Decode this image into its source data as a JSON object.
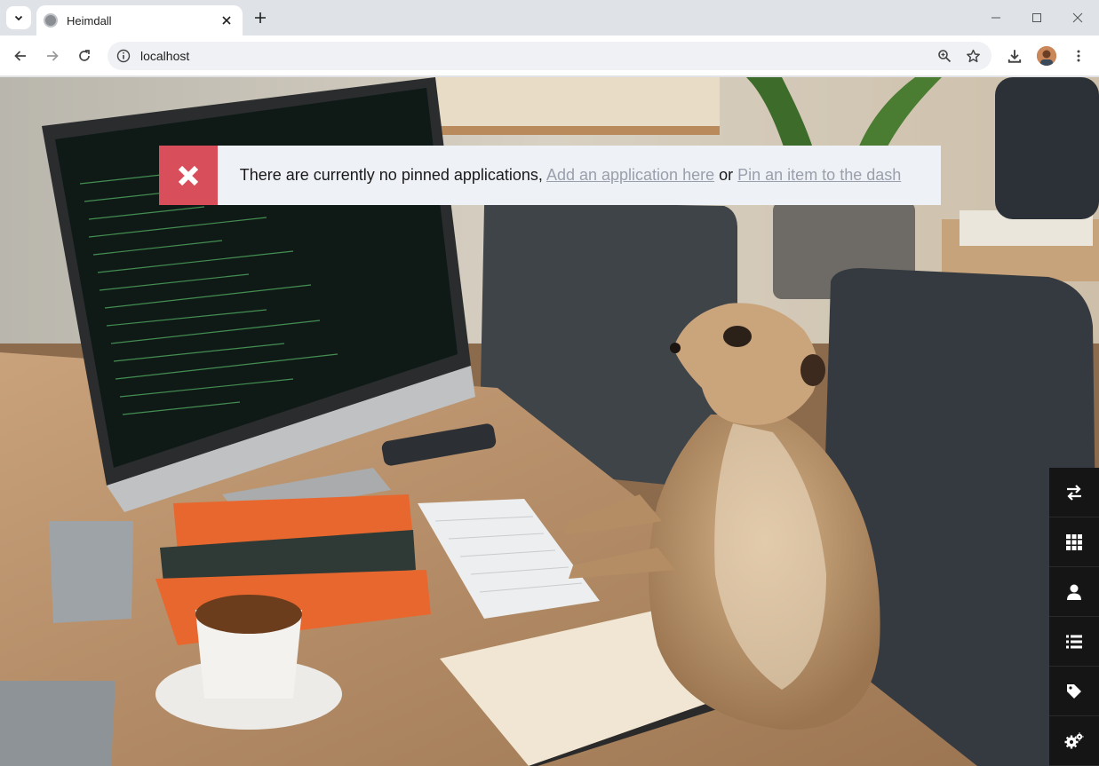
{
  "browser": {
    "tab_title": "Heimdall",
    "url": "localhost",
    "icons": {
      "tab_search": "chevron-down-icon",
      "tab_favicon": "heimdall-icon",
      "tab_close": "close-icon",
      "new_tab": "plus-icon",
      "minimize": "minimize-icon",
      "maximize": "maximize-icon",
      "close_window": "close-window-icon",
      "back": "back-arrow-icon",
      "forward": "forward-arrow-icon",
      "reload": "reload-icon",
      "site_info": "info-icon",
      "zoom": "zoom-icon",
      "bookmark": "star-icon",
      "downloads": "download-icon",
      "profile": "avatar",
      "menu": "kebab-menu-icon"
    }
  },
  "alert": {
    "message": "There are currently no pinned applications,",
    "link_add": "Add an application here",
    "joiner": "or",
    "link_pin": "Pin an item to the dash",
    "icon": "x-icon",
    "icon_bg": "#d84f5b"
  },
  "sidenav": {
    "items": [
      {
        "icon": "swap-arrows-icon"
      },
      {
        "icon": "grid-icon"
      },
      {
        "icon": "user-icon"
      },
      {
        "icon": "list-icon"
      },
      {
        "icon": "tag-icon"
      },
      {
        "icon": "cogs-icon"
      }
    ]
  }
}
